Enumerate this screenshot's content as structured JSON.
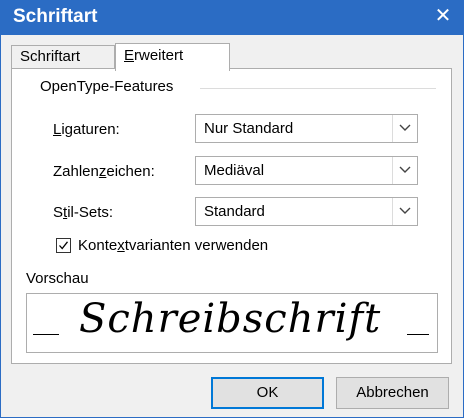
{
  "dialog": {
    "title": "Schriftart",
    "close_glyph": "✕"
  },
  "tabs": [
    {
      "label": "Schriftart"
    },
    {
      "label_pre": "",
      "label_acc": "E",
      "label_post": "rweitert",
      "active": true
    }
  ],
  "opentype": {
    "group_label": "OpenType-Features",
    "ligatures": {
      "label_pre": "",
      "label_acc": "L",
      "label_post": "igaturen:",
      "value": "Nur Standard"
    },
    "numbers": {
      "label_pre": "Zahlen",
      "label_acc": "z",
      "label_post": "eichen:",
      "value": "Mediäval"
    },
    "stylesets": {
      "label_pre": "S",
      "label_acc": "t",
      "label_post": "il-Sets:",
      "value": "Standard"
    },
    "contextual": {
      "checked": true,
      "label_pre": "Konte",
      "label_acc": "x",
      "label_post": "tvarianten verwenden"
    }
  },
  "preview": {
    "label": "Vorschau",
    "text": "Schreibschrift"
  },
  "buttons": {
    "ok": "OK",
    "cancel": "Abbrechen"
  },
  "colors": {
    "titlebar": "#2b6cc4",
    "ok_border": "#0078d7"
  },
  "icons": {
    "close": "close-icon",
    "dropdown": "chevron-down-icon",
    "check": "checkmark-icon"
  }
}
